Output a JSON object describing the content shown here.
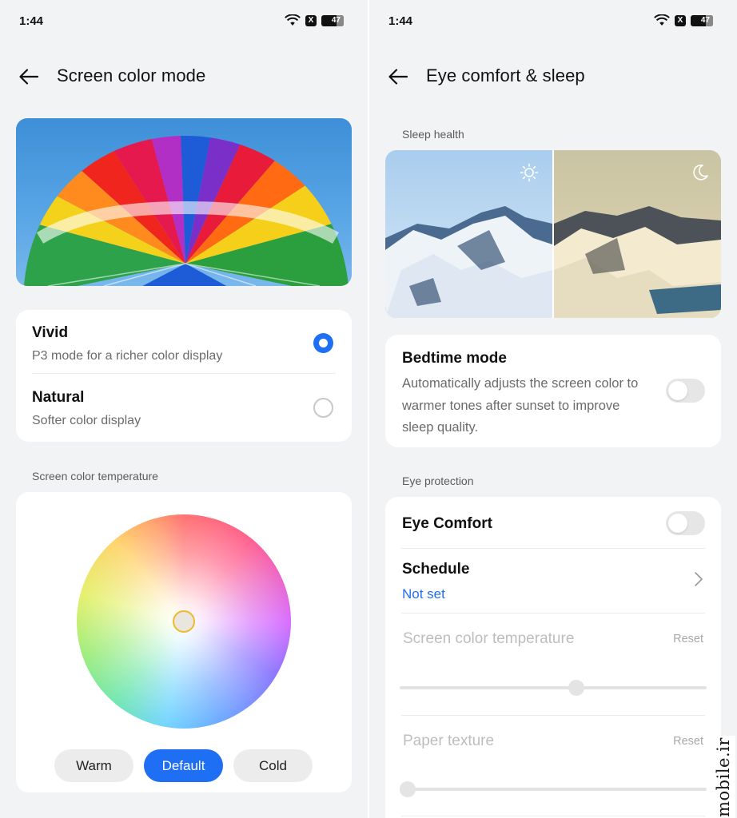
{
  "status_bar": {
    "time": "1:44",
    "battery": "47",
    "notification_badge": "X"
  },
  "left": {
    "page_title": "Screen color mode",
    "modes": [
      {
        "title": "Vivid",
        "subtitle": "P3 mode for a richer color display",
        "selected": true
      },
      {
        "title": "Natural",
        "subtitle": "Softer color display",
        "selected": false
      }
    ],
    "temperature_section_label": "Screen color temperature",
    "presets": [
      "Warm",
      "Default",
      "Cold"
    ],
    "selected_preset": "Default"
  },
  "right": {
    "page_title": "Eye comfort & sleep",
    "sleep_section_label": "Sleep health",
    "bedtime": {
      "title": "Bedtime mode",
      "description": "Automatically adjusts the screen color to warmer tones after sunset to improve sleep quality.",
      "enabled": false
    },
    "eye_section_label": "Eye protection",
    "eye_comfort": {
      "title": "Eye Comfort",
      "enabled": false
    },
    "schedule": {
      "title": "Schedule",
      "value": "Not set"
    },
    "color_temperature": {
      "title": "Screen color temperature",
      "reset_label": "Reset",
      "level": 0.58
    },
    "paper_texture": {
      "title": "Paper texture",
      "reset_label": "Reset",
      "level": 0.0
    }
  },
  "watermark": "mobile.ir",
  "colors": {
    "accent": "#1f6ff5",
    "background": "#f2f3f5",
    "card": "#ffffff",
    "handle_ring": "#f0b92a"
  }
}
